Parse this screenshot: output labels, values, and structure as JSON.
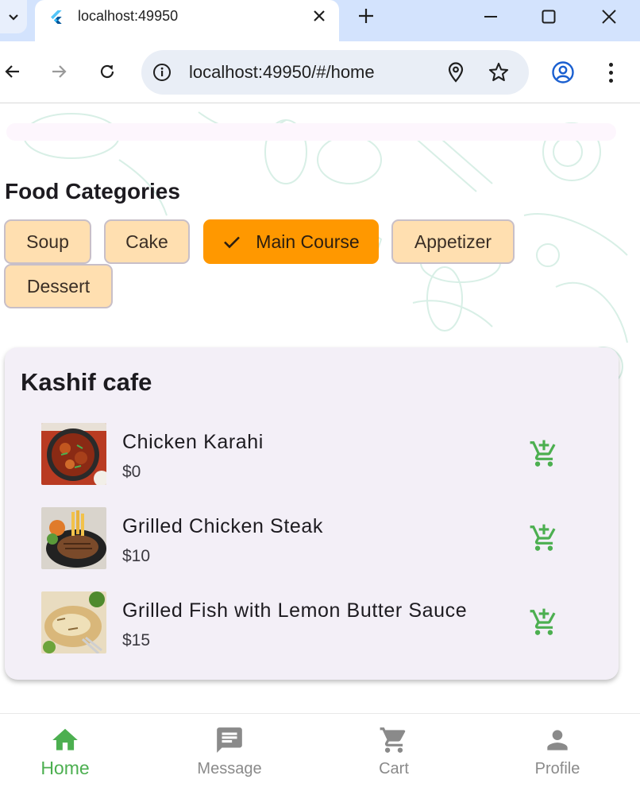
{
  "browser": {
    "tab_title": "localhost:49950",
    "url": "localhost:49950/#/home"
  },
  "page": {
    "section_title": "Food Categories",
    "categories": [
      {
        "label": "Soup",
        "selected": false
      },
      {
        "label": "Cake",
        "selected": false
      },
      {
        "label": "Main Course",
        "selected": true
      },
      {
        "label": "Appetizer",
        "selected": false
      },
      {
        "label": "Dessert",
        "selected": false
      }
    ],
    "restaurant": {
      "name": "Kashif cafe",
      "items": [
        {
          "name": "Chicken Karahi",
          "price": "$0"
        },
        {
          "name": "Grilled Chicken Steak",
          "price": "$10"
        },
        {
          "name": "Grilled Fish with Lemon Butter Sauce",
          "price": "$15"
        }
      ]
    }
  },
  "bottom_nav": {
    "items": [
      {
        "label": "Home",
        "icon": "home-icon",
        "active": true
      },
      {
        "label": "Message",
        "icon": "message-icon",
        "active": false
      },
      {
        "label": "Cart",
        "icon": "cart-icon",
        "active": false
      },
      {
        "label": "Profile",
        "icon": "person-icon",
        "active": false
      }
    ]
  },
  "colors": {
    "chip_bg": "#ffdfb0",
    "chip_selected_bg": "#ff9800",
    "accent_green": "#4caf50",
    "card_bg": "#f3eff7",
    "tabbar_bg": "#d3e3fd"
  }
}
